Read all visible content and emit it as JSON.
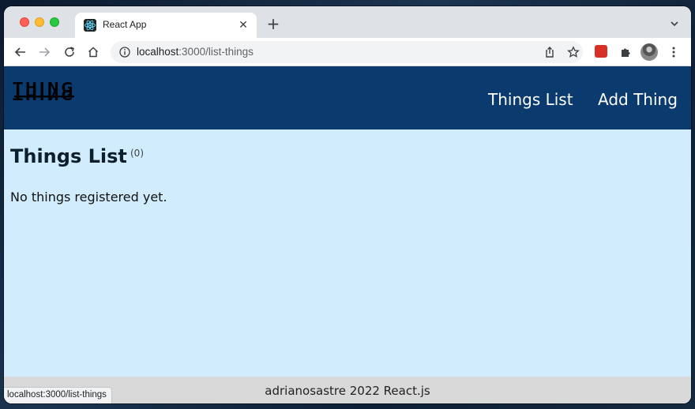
{
  "browser": {
    "tab_title": "React App",
    "url_host": "localhost",
    "url_path": ":3000/list-things",
    "status_url": "localhost:3000/list-things",
    "new_tab_label": "+",
    "close_tab_label": "✕"
  },
  "app": {
    "logo_text": "THING",
    "nav": {
      "things_list": "Things List",
      "add_thing": "Add Thing"
    },
    "page_title": "Things List",
    "count": "(0)",
    "empty_message": "No things registered yet.",
    "footer": "adrianosastre 2022 React.js",
    "colors": {
      "header_bg": "#0a3a6e",
      "page_bg": "#d1ecfc",
      "footer_bg": "#d9d9d9"
    }
  }
}
